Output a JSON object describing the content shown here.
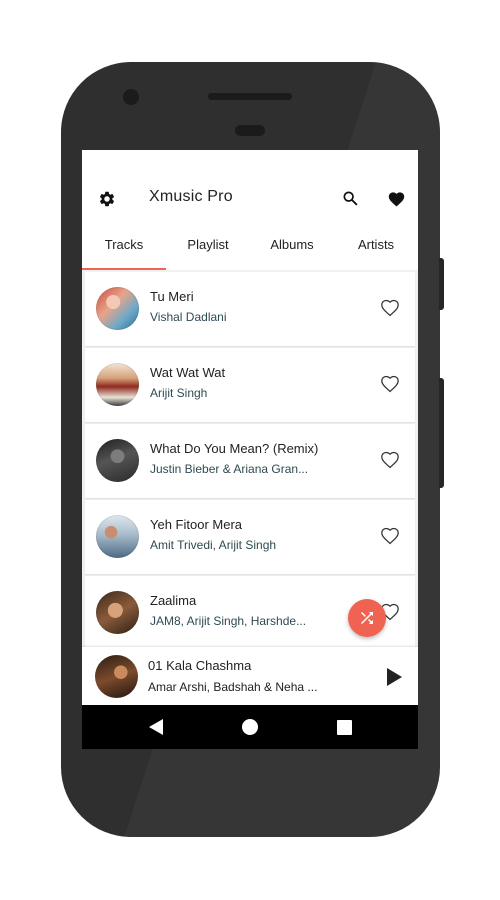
{
  "app": {
    "title": "Xmusic Pro"
  },
  "tabs": [
    {
      "label": "Tracks",
      "active": true
    },
    {
      "label": "Playlist",
      "active": false
    },
    {
      "label": "Albums",
      "active": false
    },
    {
      "label": "Artists",
      "active": false
    }
  ],
  "tracks": [
    {
      "title": "Tu Meri",
      "artist": "Vishal Dadlani",
      "favorite": false
    },
    {
      "title": "Wat Wat Wat",
      "artist": "Arijit Singh",
      "favorite": false
    },
    {
      "title": "What Do You Mean? (Remix)",
      "artist": "Justin Bieber & Ariana Gran...",
      "favorite": false
    },
    {
      "title": "Yeh Fitoor Mera",
      "artist": "Amit Trivedi, Arijit Singh",
      "favorite": false
    },
    {
      "title": "Zaalima",
      "artist": "JAM8, Arijit Singh, Harshde...",
      "favorite": false
    }
  ],
  "now_playing": {
    "title": "01 Kala Chashma",
    "artist": "Amar Arshi, Badshah & Neha ..."
  },
  "icons": {
    "settings": "gear-icon",
    "search": "search-icon",
    "favorites": "heart-filled-icon",
    "track_favorite": "heart-outline-icon",
    "shuffle": "shuffle-icon",
    "play": "play-icon",
    "nav_back": "back-triangle-icon",
    "nav_home": "home-circle-icon",
    "nav_recents": "recents-square-icon"
  },
  "colors": {
    "accent": "#f06353",
    "artist_text": "#2f4a52",
    "phone_body": "#2f2f2f"
  }
}
